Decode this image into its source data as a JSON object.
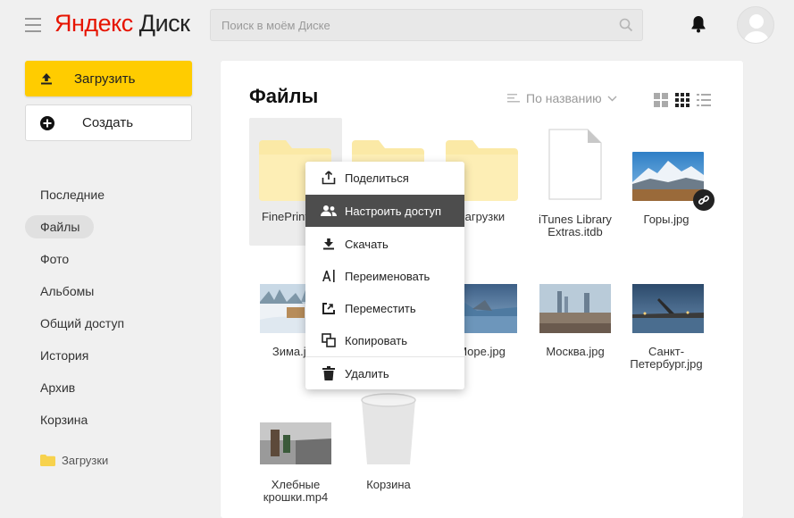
{
  "header": {
    "logo_part1": "Яндекс",
    "logo_part2": " Диск",
    "search_placeholder": "Поиск в моём Диске"
  },
  "sidebar": {
    "upload_label": "Загрузить",
    "create_label": "Создать",
    "items": [
      {
        "label": "Последние"
      },
      {
        "label": "Файлы"
      },
      {
        "label": "Фото"
      },
      {
        "label": "Альбомы"
      },
      {
        "label": "Общий доступ"
      },
      {
        "label": "История"
      },
      {
        "label": "Архив"
      },
      {
        "label": "Корзина"
      }
    ],
    "active_item": "Файлы",
    "folder_label": "Загрузки"
  },
  "main": {
    "title": "Файлы",
    "sort_label": "По названию"
  },
  "files": [
    {
      "name": "FinePrint"
    },
    {
      "name": ""
    },
    {
      "name": "Загрузки"
    },
    {
      "name": "iTunes Library\nExtras.itdb"
    },
    {
      "name": "Горы.jpg"
    },
    {
      "name": "Зима.jpg"
    },
    {
      "name": "Море.jpg"
    },
    {
      "name": "Москва.jpg"
    },
    {
      "name": "Санкт-Петербург.jpg"
    },
    {
      "name": "Хлебные\nкрошки.mp4"
    },
    {
      "name": "Корзина"
    }
  ],
  "context_menu": [
    {
      "label": "Поделиться"
    },
    {
      "label": "Настроить доступ"
    },
    {
      "label": "Скачать"
    },
    {
      "label": "Переименовать"
    },
    {
      "label": "Переместить"
    },
    {
      "label": "Копировать"
    },
    {
      "label": "Удалить"
    }
  ],
  "colors": {
    "accent": "#ffcc00",
    "logo_red": "#e61400",
    "folder": "#fbe9a6",
    "menu_active": "#4d4d4d"
  }
}
